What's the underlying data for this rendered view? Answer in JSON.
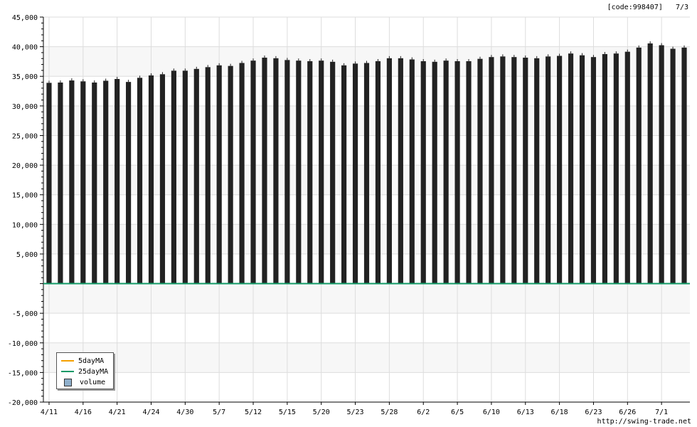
{
  "header": {
    "code_label": "[code:998407]",
    "date_label": "7/3"
  },
  "footer": {
    "url": "http://swing-trade.net"
  },
  "legend": {
    "items": [
      {
        "label": "5dayMA",
        "color": "#f5a000",
        "kind": "line"
      },
      {
        "label": "25dayMA",
        "color": "#119966",
        "kind": "line"
      },
      {
        "label": "volume",
        "color": "#8fb0cc",
        "kind": "box"
      }
    ]
  },
  "colors": {
    "bar": "#222222",
    "plot_band": "#f7f7f7",
    "grid": "#dddddd",
    "ma_line": "#119966"
  },
  "chart_data": {
    "type": "bar",
    "ylim": [
      -20000,
      45000
    ],
    "yticks": [
      -20000,
      -15000,
      -10000,
      -5000,
      5000,
      10000,
      15000,
      20000,
      25000,
      30000,
      35000,
      40000,
      45000
    ],
    "ytick_labels": [
      "-20,000",
      "-15,000",
      "-10,000",
      "-5,000",
      "5,000",
      "10,000",
      "15,000",
      "20,000",
      "25,000",
      "30,000",
      "35,000",
      "40,000",
      "45,000"
    ],
    "xtick_labels": [
      "4/11",
      "4/16",
      "4/21",
      "4/24",
      "4/30",
      "5/7",
      "5/12",
      "5/15",
      "5/20",
      "5/23",
      "5/28",
      "6/2",
      "6/5",
      "6/10",
      "6/13",
      "6/18",
      "6/23",
      "6/26",
      "7/1"
    ],
    "xtick_indices": [
      0,
      3,
      6,
      9,
      12,
      15,
      18,
      21,
      24,
      27,
      30,
      33,
      36,
      39,
      42,
      45,
      48,
      51,
      54
    ],
    "values": [
      33900,
      33950,
      34300,
      34150,
      33950,
      34250,
      34550,
      34050,
      34750,
      35150,
      35350,
      35950,
      35950,
      36250,
      36550,
      36850,
      36750,
      37250,
      37650,
      38150,
      38050,
      37750,
      37650,
      37550,
      37650,
      37450,
      36850,
      37150,
      37250,
      37550,
      38050,
      38050,
      37850,
      37550,
      37450,
      37650,
      37550,
      37550,
      37950,
      38250,
      38350,
      38250,
      38150,
      38050,
      38350,
      38450,
      38850,
      38550,
      38250,
      38750,
      38850,
      39150,
      39850,
      40550,
      40250,
      39650,
      39850
    ],
    "series": [
      {
        "name": "5dayMA",
        "values": []
      },
      {
        "name": "25dayMA",
        "values": [
          0
        ]
      },
      {
        "name": "volume",
        "values": []
      }
    ]
  }
}
